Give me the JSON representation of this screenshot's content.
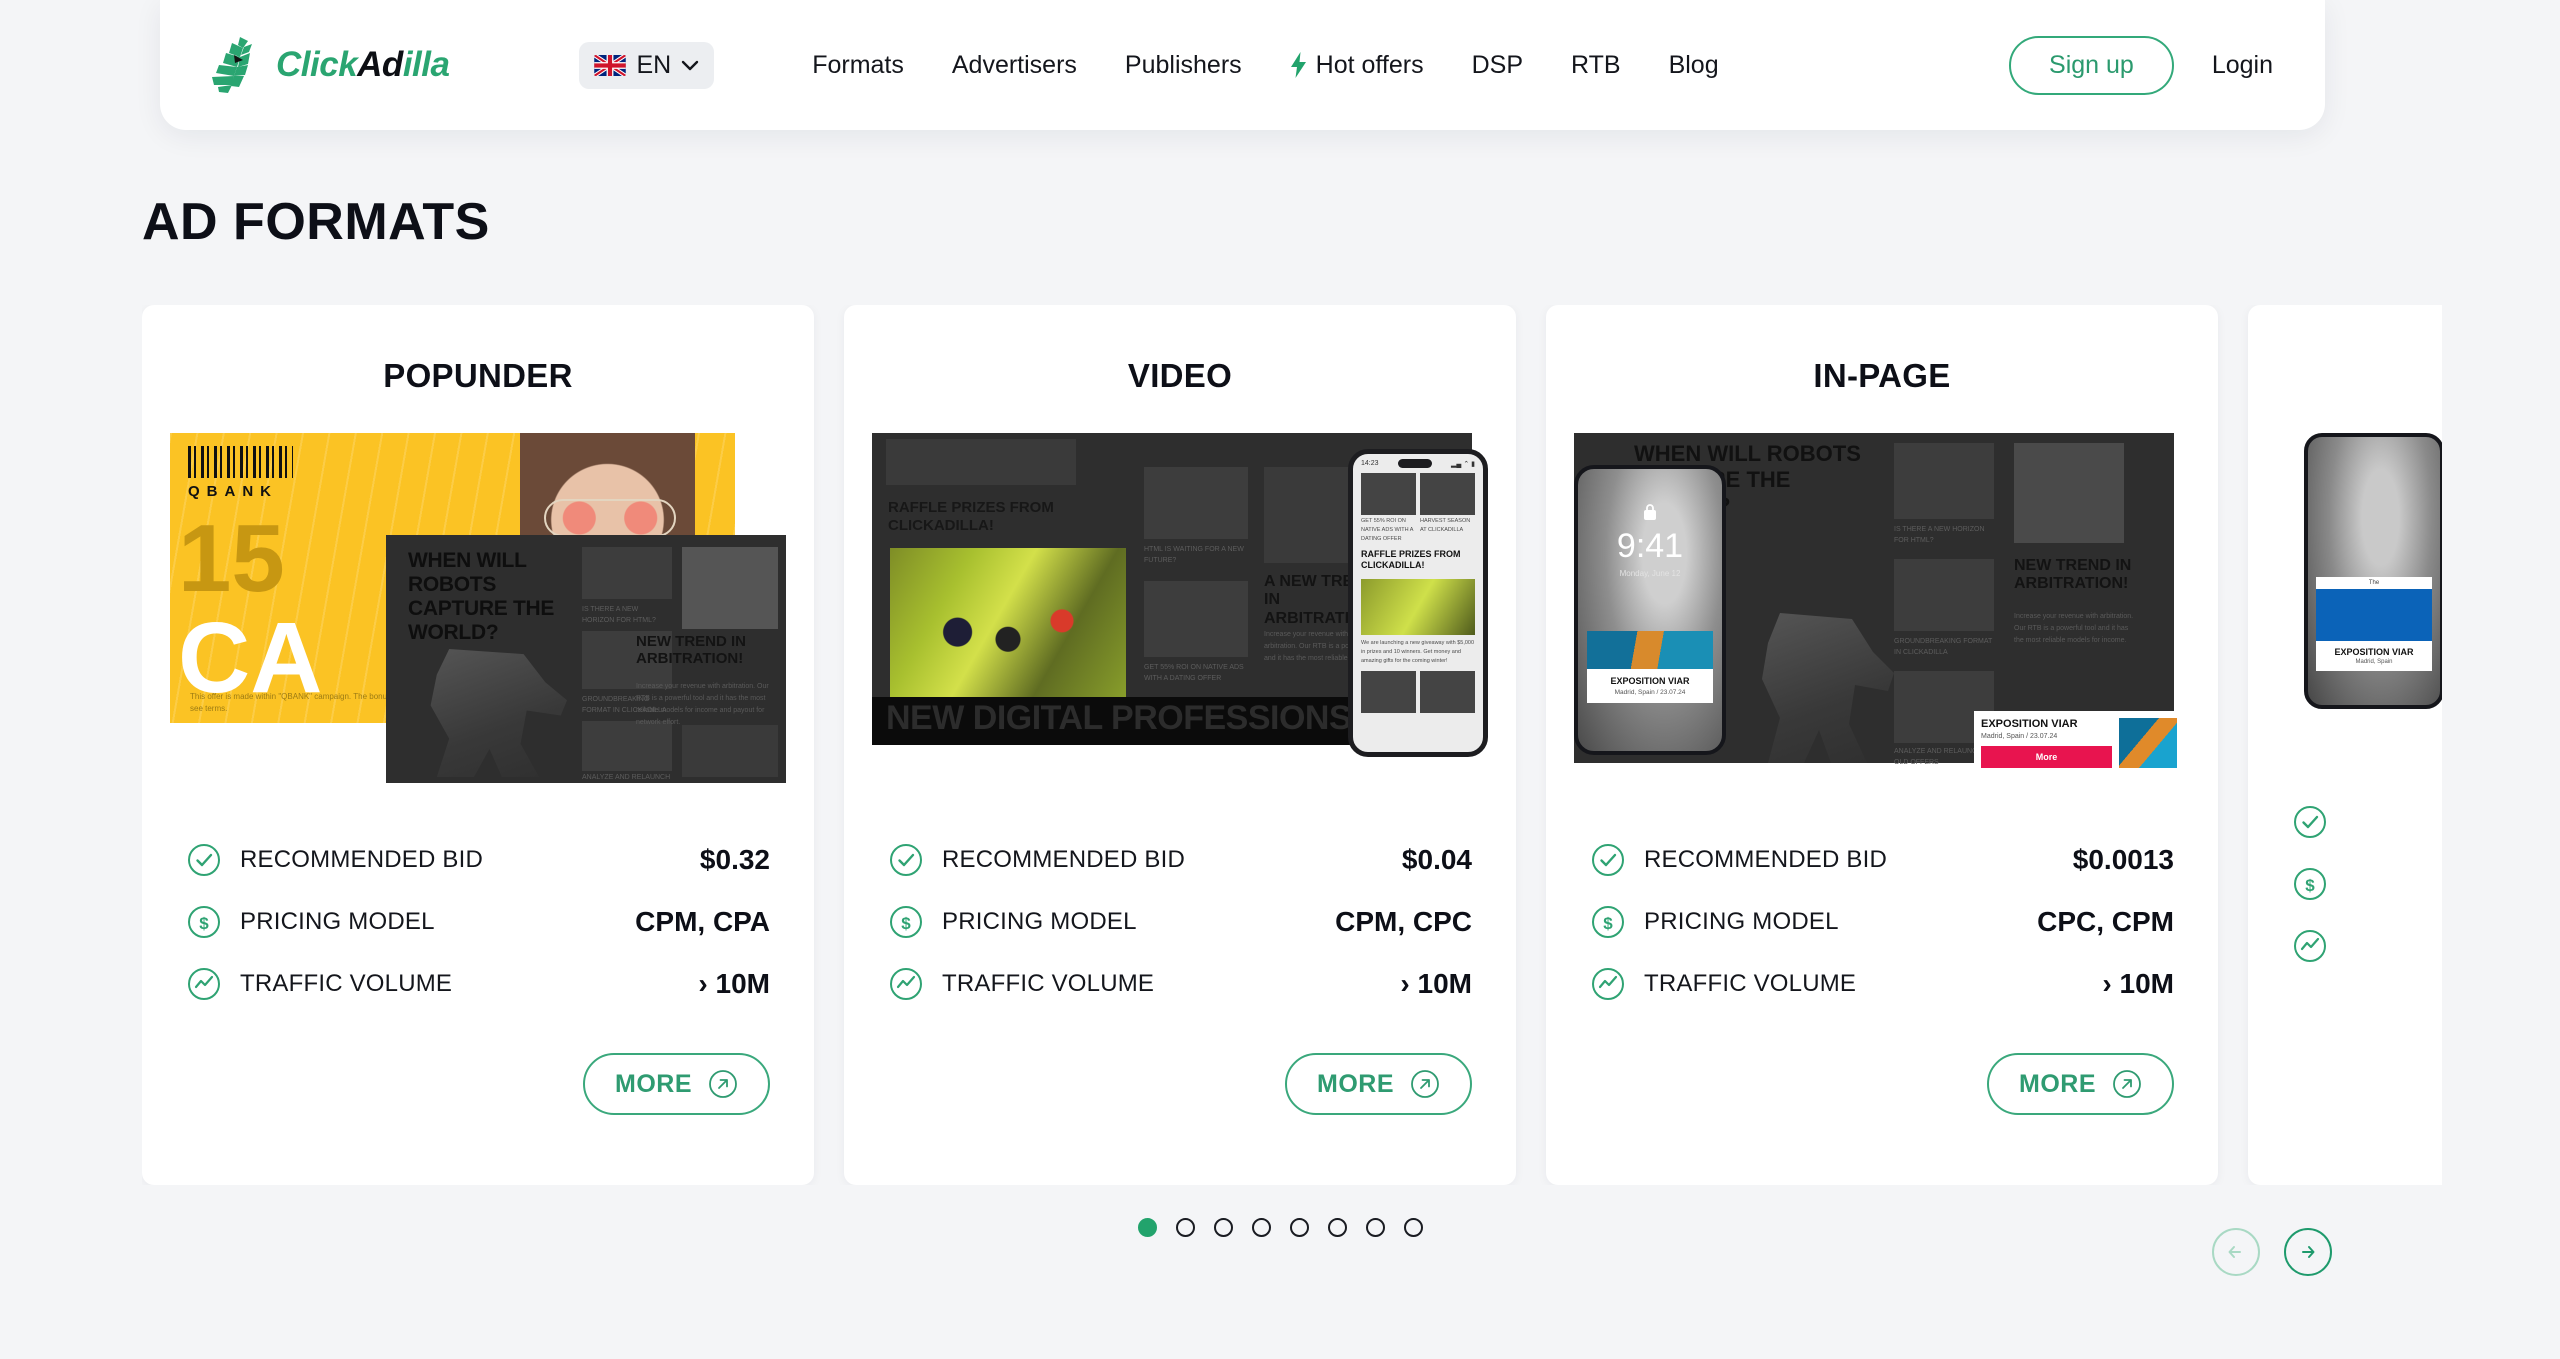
{
  "brand": {
    "name_part1": "Click",
    "name_part2": "Ad",
    "name_part3": "illa",
    "accent_green": "#22a36c",
    "logo_icon": "gorilla-logo-icon"
  },
  "header": {
    "language": {
      "code": "EN",
      "flag": "uk-flag-icon",
      "chevron": "chevron-down-icon"
    },
    "nav": [
      {
        "label": "Formats",
        "icon": null
      },
      {
        "label": "Advertisers",
        "icon": null
      },
      {
        "label": "Publishers",
        "icon": null
      },
      {
        "label": "Hot offers",
        "icon": "bolt-icon"
      },
      {
        "label": "DSP",
        "icon": null
      },
      {
        "label": "RTB",
        "icon": null
      },
      {
        "label": "Blog",
        "icon": null
      }
    ],
    "signup_label": "Sign up",
    "login_label": "Login"
  },
  "page": {
    "title": "AD FORMATS"
  },
  "stat_labels": {
    "recommended_bid": "RECOMMENDED BID",
    "pricing_model": "PRICING MODEL",
    "traffic_volume": "TRAFFIC VOLUME"
  },
  "stat_icons": {
    "recommended_bid": "check-circle-icon",
    "pricing_model": "dollar-circle-icon",
    "traffic_volume": "trend-circle-icon"
  },
  "more_button": {
    "label": "MORE",
    "icon": "arrow-up-right-circle-icon"
  },
  "cards": [
    {
      "title": "POPUNDER",
      "recommended_bid": "$0.32",
      "pricing_model": "CPM, CPA",
      "traffic_volume": "› 10M",
      "art": {
        "kind": "popunder-preview",
        "ad_brand": "QBANK",
        "ad_number": "15",
        "ad_word": "CA",
        "ad_fineprint": "This offer is made within \"QBANK\" campaign. The bonus amount is also limited. For details see terms.",
        "overlay_headline": "WHEN WILL ROBOTS CAPTURE THE WORLD?",
        "overlay_side_headline": "NEW TREND IN ARBITRATION!",
        "overlay_caption_1": "IS THERE A NEW HORIZON FOR HTML?",
        "overlay_caption_2": "GROUNDBREAKING FORMAT IN CLICKADILLA",
        "overlay_caption_3": "ANALYZE AND RELAUNCH OLD OFFERS"
      }
    },
    {
      "title": "VIDEO",
      "recommended_bid": "$0.04",
      "pricing_model": "CPM, CPC",
      "traffic_volume": "› 10M",
      "art": {
        "kind": "video-preview",
        "headline": "RAFFLE PRIZES FROM CLICKADILLA!",
        "band_text": "NEW DIGITAL PROFESSIONS",
        "caption_1": "HTML IS WAITING FOR A NEW FUTURE?",
        "caption_2": "GET 55% ROI ON NATIVE ADS WITH A DATING OFFER",
        "side_headline": "A NEW TREND IN ARBITRATION",
        "phone": {
          "time": "14:23",
          "tile_1": "GET 55% ROI ON NATIVE ADS WITH A DATING OFFER",
          "tile_2": "HARVEST SEASON AT CLICKADILLA",
          "headline": "RAFFLE PRIZES FROM CLICKADILLA!",
          "body": "We are launching a new giveaway with $5,000 in prizes and 10 winners. Get money and amazing gifts for the coming winter!"
        }
      }
    },
    {
      "title": "IN-PAGE",
      "recommended_bid": "$0.0013",
      "pricing_model": "CPC, CPM",
      "traffic_volume": "› 10M",
      "art": {
        "kind": "inpage-preview",
        "headline": "WHEN WILL ROBOTS CAPTURE THE WORLD?",
        "side_headline": "NEW TREND IN ARBITRATION!",
        "caption_1": "IS THERE A NEW HORIZON FOR HTML?",
        "caption_2": "GROUNDBREAKING FORMAT IN CLICKADILLA",
        "caption_3": "ANALYZE AND RELAUNCH OLD OFFERS",
        "phone": {
          "time": "9:41",
          "date": "Monday, June 12",
          "lock_icon": "lock-icon"
        },
        "notification": {
          "title": "EXPOSITION VIAR",
          "subtitle": "Madrid, Spain  /  23.07.24",
          "cta": "More"
        }
      }
    },
    {
      "title": "",
      "recommended_bid": "",
      "pricing_model": "",
      "traffic_volume": "",
      "art": {
        "kind": "peek-preview",
        "notification": {
          "title": "EXPOSITION VIAR",
          "subtitle": "Madrid, Spain",
          "top": "The"
        }
      }
    }
  ],
  "pagination": {
    "total": 8,
    "active_index": 0,
    "prev_icon": "arrow-left-icon",
    "next_icon": "arrow-right-icon",
    "prev_enabled": false,
    "next_enabled": true
  }
}
